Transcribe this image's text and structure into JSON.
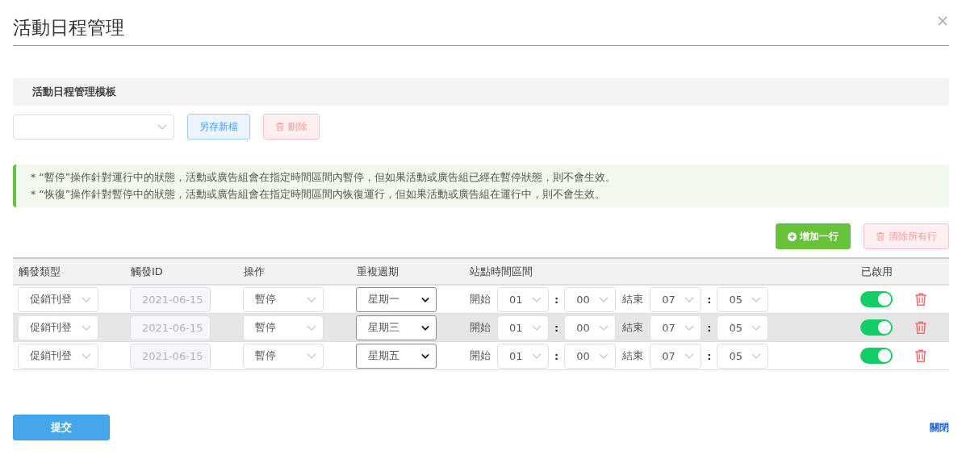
{
  "dialog": {
    "title": "活動日程管理"
  },
  "template": {
    "heading": "活動日程管理模板",
    "save_button": "另存新檔",
    "delete_button": "刪除"
  },
  "notes": [
    "* “暫停”操作針對運行中的狀態，活動或廣告組會在指定時間區間內暫停，但如果活動或廣告組已經在暫停狀態，則不會生效。",
    "* “恢復”操作針對暫停中的狀態，活動或廣告組會在指定時間區間內恢復運行，但如果活動或廣告組在運行中，則不會生效。"
  ],
  "actions": {
    "add_row": "增加一行",
    "clear_rows": "清除所有行"
  },
  "table": {
    "columns": [
      "觸發類型",
      "觸發ID",
      "操作",
      "重複週期",
      "站點時間區間",
      "已啟用"
    ],
    "rows": [
      {
        "trigger_type": "促銷刊登",
        "trigger_id": "2021-06-15",
        "operation": "暫停",
        "repeat": "星期一",
        "start_label": "開始",
        "start_hour": "01",
        "start_minute": "00",
        "end_label": "結束",
        "end_hour": "07",
        "end_minute": "05",
        "enabled": true,
        "highlighted": false
      },
      {
        "trigger_type": "促銷刊登",
        "trigger_id": "2021-06-15",
        "operation": "暫停",
        "repeat": "星期三",
        "start_label": "開始",
        "start_hour": "01",
        "start_minute": "00",
        "end_label": "結束",
        "end_hour": "07",
        "end_minute": "05",
        "enabled": true,
        "highlighted": true
      },
      {
        "trigger_type": "促銷刊登",
        "trigger_id": "2021-06-15",
        "operation": "暫停",
        "repeat": "星期五",
        "start_label": "開始",
        "start_hour": "01",
        "start_minute": "00",
        "end_label": "結束",
        "end_hour": "07",
        "end_minute": "05",
        "enabled": true,
        "highlighted": false
      }
    ],
    "separator": ":"
  },
  "footer": {
    "submit": "提交",
    "close": "關閉"
  }
}
